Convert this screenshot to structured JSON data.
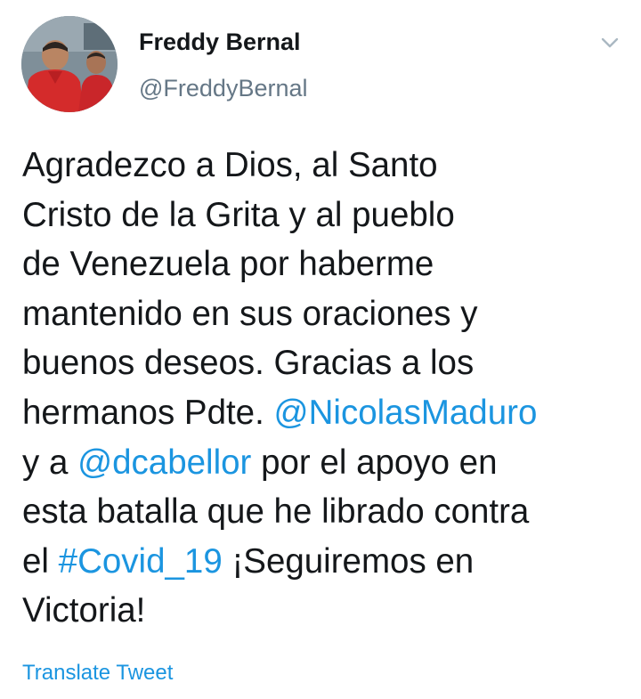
{
  "author": {
    "display_name": "Freddy Bernal",
    "handle": "@FreddyBernal"
  },
  "icons": {
    "avatar": "profile-photo-avatar",
    "menu": "chevron-down-icon"
  },
  "tweet": {
    "lines": [
      [
        {
          "text": "Agradezco a Dios, al Santo"
        }
      ],
      [
        {
          "text": "Cristo de la Grita y al pueblo"
        }
      ],
      [
        {
          "text": "de Venezuela por haberme"
        }
      ],
      [
        {
          "text": "mantenido en sus oraciones y"
        }
      ],
      [
        {
          "text": "buenos deseos. Gracias a los"
        }
      ],
      [
        {
          "text": "hermanos Pdte. "
        },
        {
          "text": "@NicolasMaduro",
          "link": true,
          "kind": "mention"
        }
      ],
      [
        {
          "text": "y a "
        },
        {
          "text": "@dcabellor",
          "link": true,
          "kind": "mention"
        },
        {
          "text": " por el apoyo en"
        }
      ],
      [
        {
          "text": "esta batalla que he librado contra"
        }
      ],
      [
        {
          "text": "el "
        },
        {
          "text": "#Covid_19",
          "link": true,
          "kind": "hashtag"
        },
        {
          "text": " ¡Seguiremos en"
        }
      ],
      [
        {
          "text": "Victoria!"
        }
      ]
    ]
  },
  "translate_label": "Translate Tweet",
  "colors": {
    "link": "#1b95e0",
    "text": "#14171a",
    "secondary": "#657786",
    "background": "#ffffff"
  }
}
